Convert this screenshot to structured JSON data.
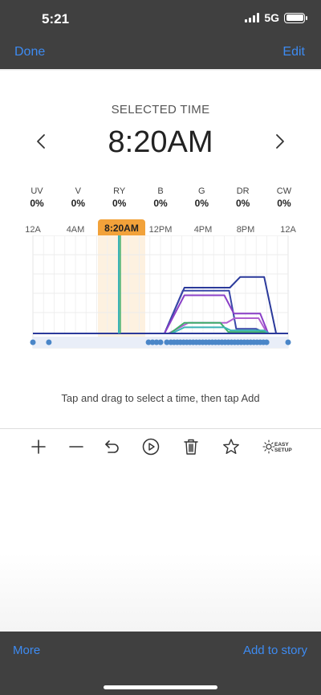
{
  "status_bar": {
    "time": "5:21",
    "network": "5G"
  },
  "nav": {
    "done_label": "Done",
    "edit_label": "Edit"
  },
  "header": {
    "label": "SELECTED TIME",
    "time": "8:20AM"
  },
  "channels": [
    {
      "name": "UV",
      "value": "0%"
    },
    {
      "name": "V",
      "value": "0%"
    },
    {
      "name": "RY",
      "value": "0%"
    },
    {
      "name": "B",
      "value": "0%"
    },
    {
      "name": "G",
      "value": "0%"
    },
    {
      "name": "DR",
      "value": "0%"
    },
    {
      "name": "CW",
      "value": "0%"
    }
  ],
  "timeline": {
    "ticks": [
      "12A",
      "4AM",
      "12PM",
      "4PM",
      "8PM",
      "12A"
    ],
    "selected_tick": "8:20AM",
    "selected_hour": 8.33,
    "colors": {
      "accent": "#f2a23a",
      "navy": "#2b3a9b",
      "purple": "#8a3fc7",
      "green": "#3fae6a",
      "teal": "#3bb3b5",
      "dot": "#4a86c8"
    },
    "series": [
      {
        "id": "navy-a",
        "color": "#2b3a9b",
        "points": [
          [
            0,
            0
          ],
          [
            16.5,
            0
          ],
          [
            19,
            30
          ],
          [
            24.7,
            30
          ],
          [
            26,
            37
          ],
          [
            29,
            37
          ],
          [
            30.5,
            0
          ],
          [
            24,
            0
          ]
        ]
      },
      {
        "id": "navy-b",
        "color": "#3a48a8",
        "points": [
          [
            16.5,
            0
          ],
          [
            18.8,
            28
          ],
          [
            24.6,
            28
          ],
          [
            25.5,
            3
          ],
          [
            28,
            3
          ],
          [
            29.3,
            0
          ]
        ]
      },
      {
        "id": "purple",
        "color": "#8a3fc7",
        "points": [
          [
            16.5,
            0
          ],
          [
            19,
            25
          ],
          [
            24,
            25
          ],
          [
            25.2,
            13
          ],
          [
            28.5,
            13
          ],
          [
            29.5,
            0
          ]
        ]
      },
      {
        "id": "purple-b",
        "color": "#b060d0",
        "points": [
          [
            17,
            0
          ],
          [
            19.5,
            7
          ],
          [
            24.3,
            7
          ],
          [
            25.3,
            10
          ],
          [
            28.3,
            10
          ],
          [
            29.4,
            0
          ]
        ]
      },
      {
        "id": "green",
        "color": "#3fae6a",
        "points": [
          [
            17.2,
            0
          ],
          [
            19,
            7
          ],
          [
            23.5,
            7
          ],
          [
            24.5,
            1
          ],
          [
            29.2,
            1
          ],
          [
            29.6,
            0
          ]
        ]
      },
      {
        "id": "teal",
        "color": "#3bb3b5",
        "points": [
          [
            17.4,
            0
          ],
          [
            19,
            4
          ],
          [
            24,
            4
          ],
          [
            24.8,
            2
          ],
          [
            29,
            2
          ],
          [
            29.6,
            0
          ]
        ]
      }
    ],
    "event_hours": [
      0,
      2,
      14.5,
      15,
      15.5,
      16,
      16.8,
      17.3,
      17.7,
      18.1,
      18.5,
      18.9,
      19.3,
      19.7,
      20.1,
      20.5,
      20.9,
      21.3,
      21.7,
      22.1,
      22.5,
      22.9,
      23.3,
      23.7,
      24.1,
      24.5,
      24.9,
      25.3,
      25.7,
      26.1,
      26.5,
      26.9,
      27.3,
      27.7,
      28.1,
      28.5,
      28.9,
      29.3,
      32
    ]
  },
  "hint": "Tap and drag to select a time, then tap Add",
  "toolbar": [
    {
      "name": "add-button",
      "icon": "plus-icon"
    },
    {
      "name": "remove-button",
      "icon": "minus-icon"
    },
    {
      "name": "undo-button",
      "icon": "undo-icon"
    },
    {
      "name": "play-button",
      "icon": "play-icon"
    },
    {
      "name": "delete-button",
      "icon": "trash-icon"
    },
    {
      "name": "favorite-button",
      "icon": "star-icon"
    },
    {
      "name": "easy-setup-button",
      "icon": "easy-setup-icon",
      "label_line1": "EASY",
      "label_line2": "SETUP"
    }
  ],
  "bottom_bar": {
    "more_label": "More",
    "add_story_label": "Add to story"
  }
}
